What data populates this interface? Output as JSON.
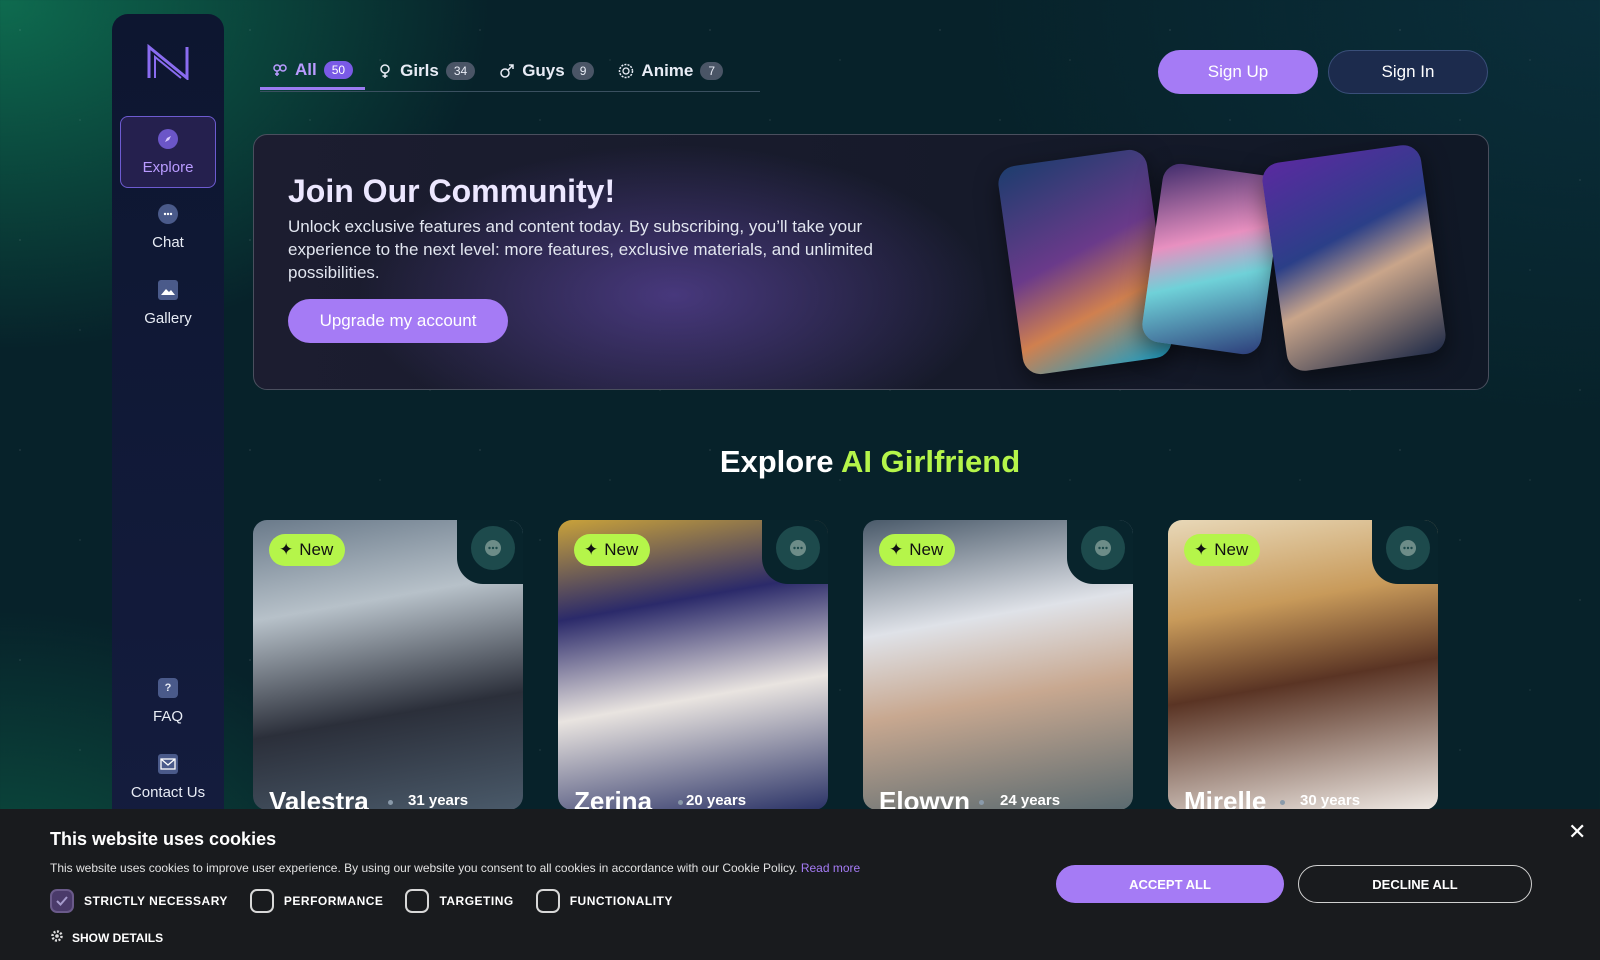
{
  "colors": {
    "accent": "#a57bf5",
    "lime": "#b5f54a",
    "sidebar": "#0d1630"
  },
  "sidebar": {
    "logo": "N",
    "items": [
      {
        "label": "Explore",
        "icon": "compass-icon",
        "active": true
      },
      {
        "label": "Chat",
        "icon": "chat-bubble-icon"
      },
      {
        "label": "Gallery",
        "icon": "image-icon"
      },
      {
        "label": "FAQ",
        "icon": "question-icon"
      },
      {
        "label": "Contact Us",
        "icon": "envelope-icon"
      }
    ]
  },
  "tabs": [
    {
      "label": "All",
      "count": "50",
      "icon": "couple-icon",
      "active": true
    },
    {
      "label": "Girls",
      "count": "34",
      "icon": "female-icon"
    },
    {
      "label": "Guys",
      "count": "9",
      "icon": "male-icon"
    },
    {
      "label": "Anime",
      "count": "7",
      "icon": "anime-icon"
    }
  ],
  "header": {
    "signup_label": "Sign Up",
    "signin_label": "Sign In"
  },
  "banner": {
    "title": "Join Our Community!",
    "text": "Unlock exclusive features and content today. By subscribing, you’ll take your experience to the next level: more features, exclusive materials, and unlimited possibilities.",
    "button_label": "Upgrade my account"
  },
  "section": {
    "title_prefix": "Explore",
    "title_accent": "AI Girlfriend"
  },
  "cards": [
    {
      "name": "Valestra",
      "age": "31 years",
      "badge": "New"
    },
    {
      "name": "Zerina",
      "age": "20 years",
      "badge": "New"
    },
    {
      "name": "Elowyn",
      "age": "24 years",
      "badge": "New"
    },
    {
      "name": "Mirelle",
      "age": "30 years",
      "badge": "New"
    }
  ],
  "cookie": {
    "title": "This website uses cookies",
    "text": "This website uses cookies to improve user experience. By using our website you consent to all cookies in accordance with our Cookie Policy.",
    "read_more": "Read more",
    "options": [
      {
        "label": "STRICTLY NECESSARY",
        "checked": true
      },
      {
        "label": "PERFORMANCE",
        "checked": false
      },
      {
        "label": "TARGETING",
        "checked": false
      },
      {
        "label": "FUNCTIONALITY",
        "checked": false
      }
    ],
    "show_details": "SHOW DETAILS",
    "accept_label": "ACCEPT ALL",
    "decline_label": "DECLINE ALL",
    "close_glyph": "✕"
  }
}
